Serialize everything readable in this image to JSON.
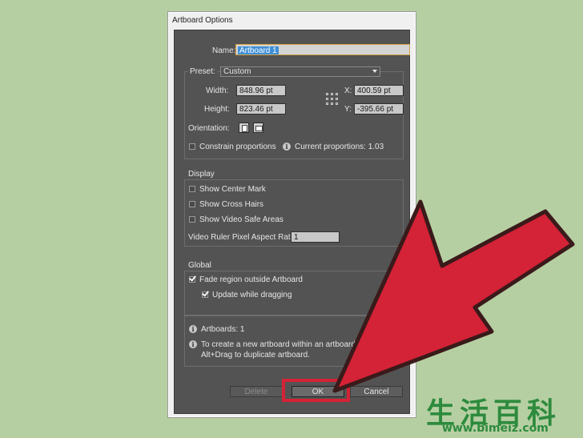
{
  "window": {
    "title": "Artboard Options"
  },
  "name": {
    "label": "Name:",
    "value": "Artboard 1"
  },
  "preset": {
    "label": "Preset:",
    "value": "Custom"
  },
  "size": {
    "width_label": "Width:",
    "width_value": "848.96 pt",
    "height_label": "Height:",
    "height_value": "823.46 pt",
    "x_label": "X:",
    "x_value": "400.59 pt",
    "y_label": "Y:",
    "y_value": "-395.66 pt"
  },
  "orientation": {
    "label": "Orientation:"
  },
  "constrain": {
    "label": "Constrain proportions",
    "checked": false
  },
  "proportions": {
    "label": "Current proportions: 1.03"
  },
  "display": {
    "title": "Display",
    "center_mark": "Show Center Mark",
    "cross_hairs": "Show Cross Hairs",
    "video_safe": "Show Video Safe Areas",
    "ratio_label": "Video Ruler Pixel Aspect Ratio:",
    "ratio_value": "1"
  },
  "global": {
    "title": "Global",
    "fade": "Fade region outside Artboard",
    "fade_checked": true,
    "update": "Update while dragging",
    "update_checked": true
  },
  "info": {
    "artboards": "Artboards: 1",
    "hint_line1": "To create a new artboard within an artboard, pre",
    "hint_line2": "Alt+Drag to duplicate artboard."
  },
  "buttons": {
    "delete": "Delete",
    "ok": "OK",
    "cancel": "Cancel"
  },
  "overlay": {
    "arrow_color": "#d42236",
    "highlight_color": "#d42236"
  },
  "watermark": {
    "chars": "生活百科",
    "url": "www.bimeiz.com"
  }
}
